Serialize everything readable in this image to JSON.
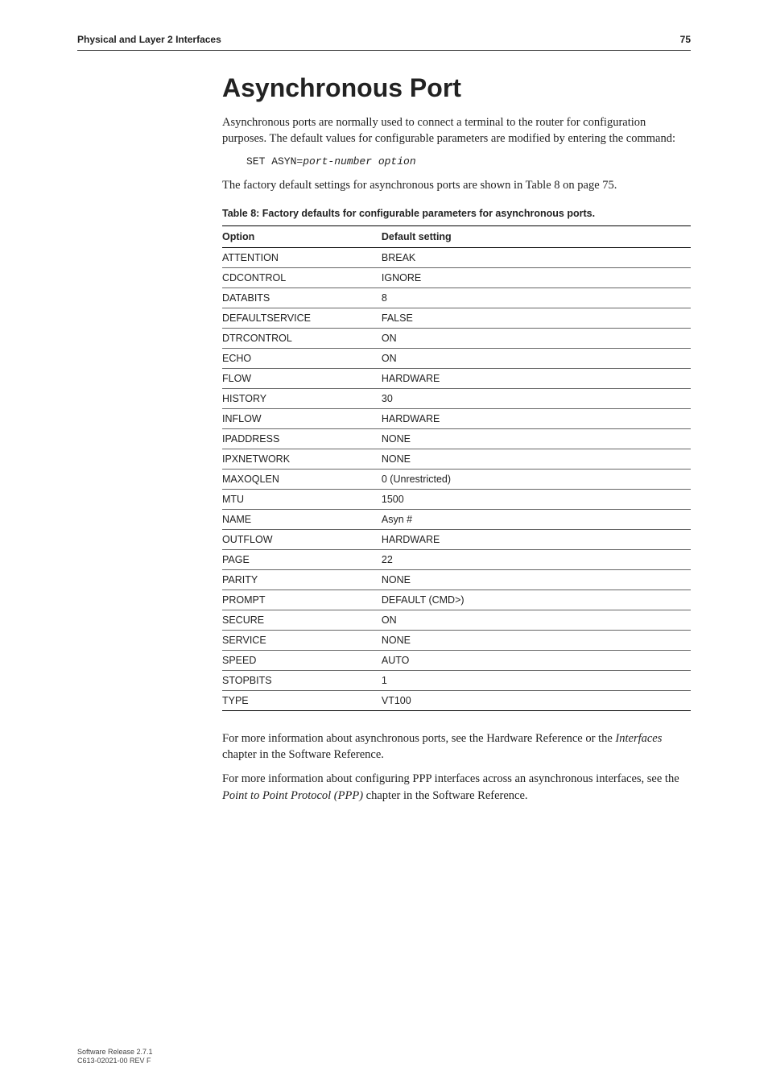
{
  "header": {
    "left": "Physical and Layer 2 Interfaces",
    "right": "75"
  },
  "title": "Asynchronous Port",
  "para1": "Asynchronous ports are normally used to connect a terminal to the router for configuration purposes. The default values for configurable parameters are modified by entering the command:",
  "cmd": {
    "prefix": "SET ASYN=",
    "args": "port-number option"
  },
  "para2": "The factory default settings for asynchronous ports are shown in Table 8 on page 75.",
  "table": {
    "caption": "Table 8: Factory defaults for configurable parameters for asynchronous ports.",
    "head": {
      "col1": "Option",
      "col2": "Default setting"
    },
    "rows": [
      {
        "opt": "ATTENTION",
        "val": "BREAK"
      },
      {
        "opt": "CDCONTROL",
        "val": "IGNORE"
      },
      {
        "opt": "DATABITS",
        "val": "8"
      },
      {
        "opt": "DEFAULTSERVICE",
        "val": "FALSE"
      },
      {
        "opt": "DTRCONTROL",
        "val": "ON"
      },
      {
        "opt": "ECHO",
        "val": "ON"
      },
      {
        "opt": "FLOW",
        "val": "HARDWARE"
      },
      {
        "opt": "HISTORY",
        "val": "30"
      },
      {
        "opt": "INFLOW",
        "val": "HARDWARE"
      },
      {
        "opt": "IPADDRESS",
        "val": "NONE"
      },
      {
        "opt": "IPXNETWORK",
        "val": "NONE"
      },
      {
        "opt": "MAXOQLEN",
        "val": "0 (Unrestricted)"
      },
      {
        "opt": "MTU",
        "val": "1500"
      },
      {
        "opt": "NAME",
        "val": "Asyn #"
      },
      {
        "opt": "OUTFLOW",
        "val": "HARDWARE"
      },
      {
        "opt": "PAGE",
        "val": "22"
      },
      {
        "opt": "PARITY",
        "val": "NONE"
      },
      {
        "opt": "PROMPT",
        "val": "DEFAULT (CMD>)"
      },
      {
        "opt": "SECURE",
        "val": "ON"
      },
      {
        "opt": "SERVICE",
        "val": "NONE"
      },
      {
        "opt": "SPEED",
        "val": "AUTO"
      },
      {
        "opt": "STOPBITS",
        "val": "1"
      },
      {
        "opt": "TYPE",
        "val": "VT100"
      }
    ]
  },
  "para3_pre": "For more information about asynchronous ports, see the Hardware Reference or the ",
  "para3_ital": "Interfaces",
  "para3_post": " chapter in the Software Reference.",
  "para4_pre": "For more information about configuring PPP interfaces across an asynchronous interfaces, see the ",
  "para4_ital": "Point to Point Protocol (PPP)",
  "para4_post": " chapter in the Software Reference.",
  "footer": {
    "line1": "Software Release 2.7.1",
    "line2": "C613-02021-00 REV F"
  }
}
